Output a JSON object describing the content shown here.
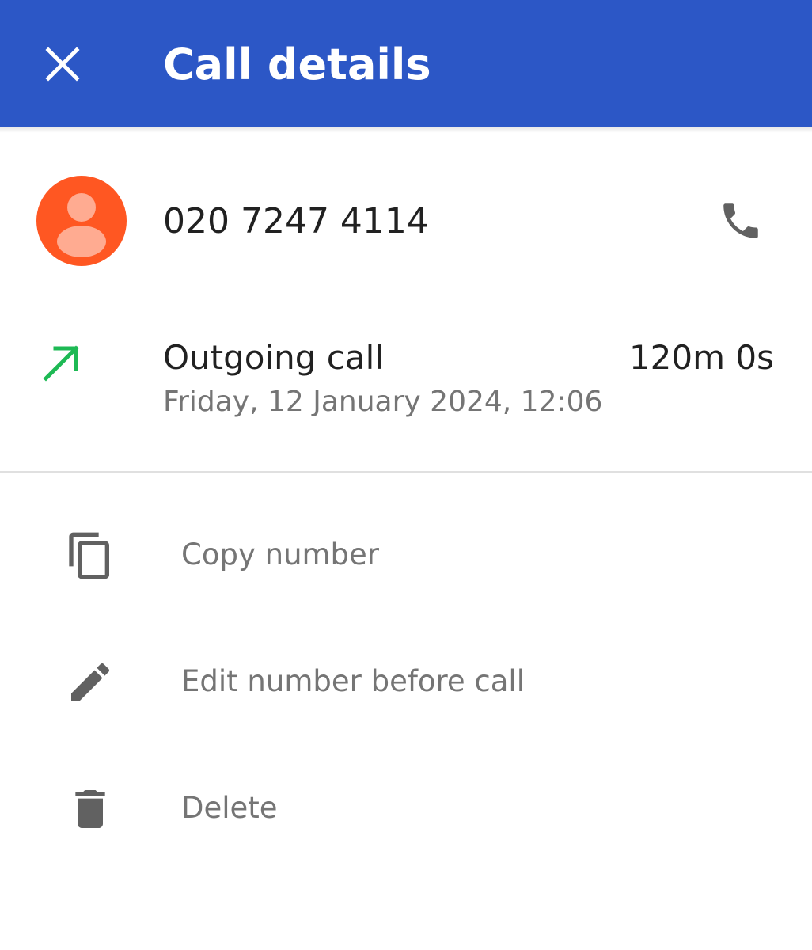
{
  "app_bar": {
    "title": "Call details",
    "close_icon": "close-icon",
    "background_color": "#2c57c6"
  },
  "contact": {
    "number": "020 7247 4114",
    "avatar_icon": "person-icon",
    "avatar_color": "#ff5722",
    "call_icon": "phone-icon"
  },
  "call": {
    "type": "Outgoing call",
    "duration": "120m 0s",
    "datetime": "Friday, 12 January 2024, 12:06",
    "direction_icon": "outgoing-arrow-icon",
    "direction_color": "#1db954"
  },
  "actions": [
    {
      "label": "Copy number",
      "icon": "copy-icon"
    },
    {
      "label": "Edit number before call",
      "icon": "pencil-icon"
    },
    {
      "label": "Delete",
      "icon": "trash-icon"
    }
  ]
}
